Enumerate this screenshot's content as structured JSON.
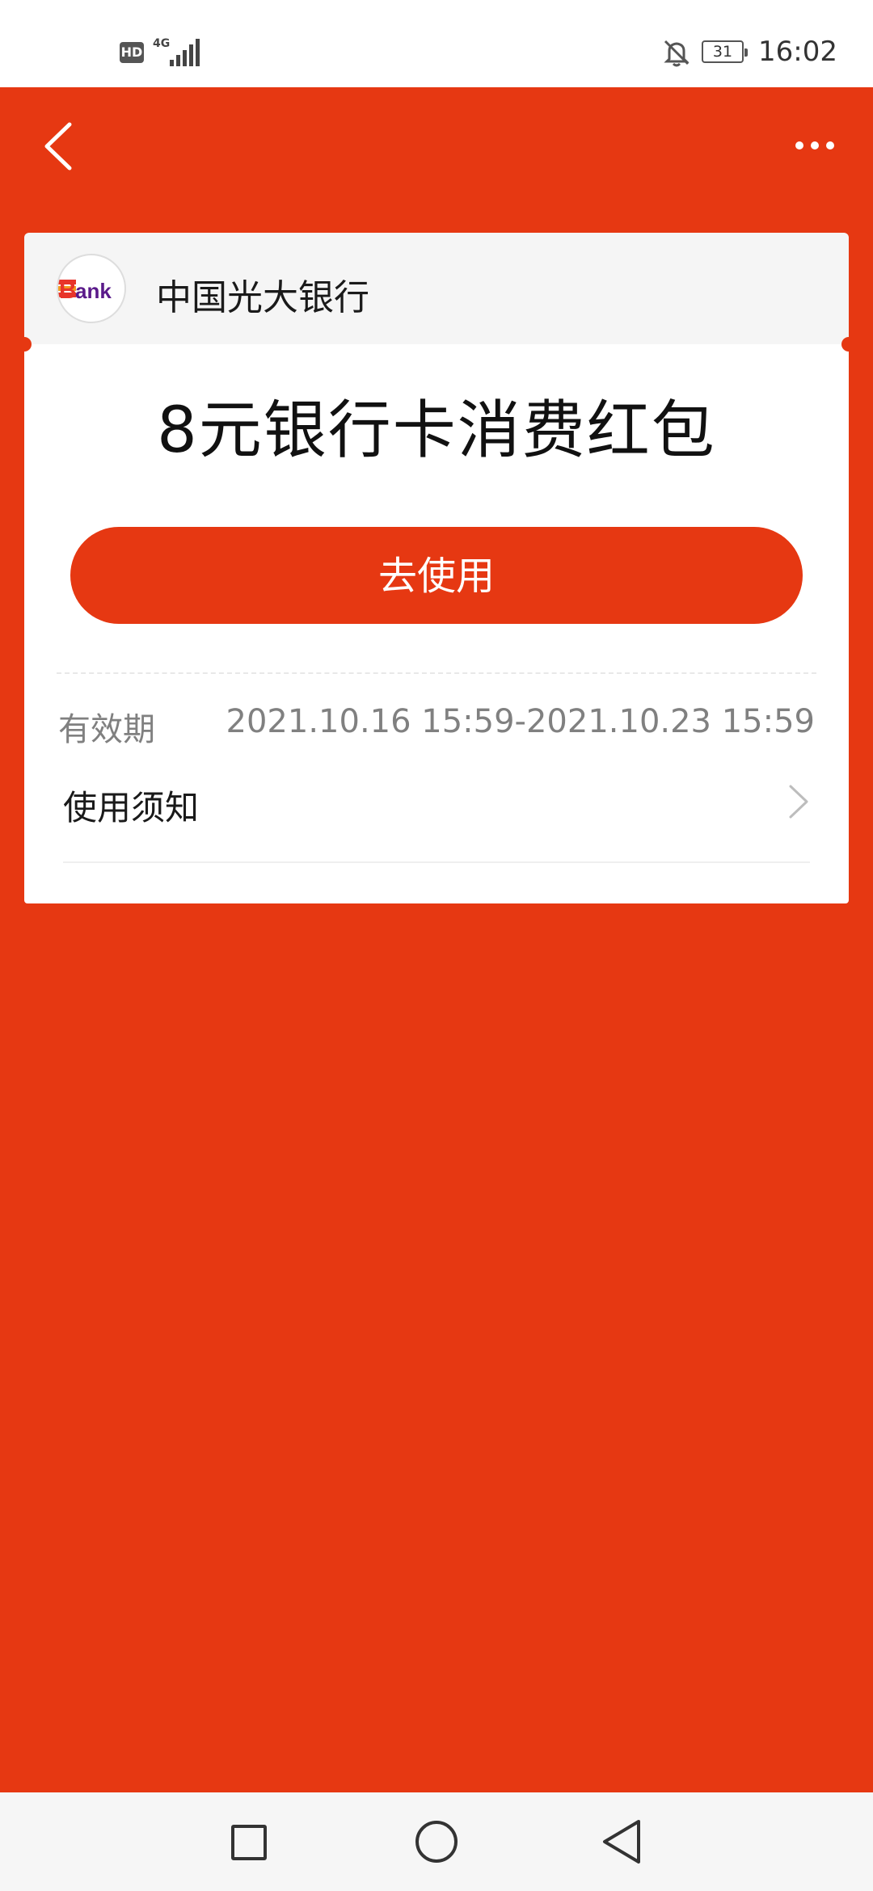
{
  "status_bar": {
    "hd": "HD",
    "network": "4G",
    "battery": "31",
    "time": "16:02"
  },
  "header": {
    "back_icon": "chevron-left-icon",
    "more_icon": "more-horizontal-icon"
  },
  "card": {
    "bank_logo_text": "Bank",
    "bank_name": "中国光大银行",
    "title": "8元银行卡消费红包",
    "use_button": "去使用",
    "validity_label": "有效期",
    "validity_value": "2021.10.16 15:59-2021.10.23 15:59",
    "notice_label": "使用须知"
  },
  "nav_bar": {
    "recent": "square-icon",
    "home": "circle-icon",
    "back": "triangle-back-icon"
  },
  "colors": {
    "accent": "#E63812",
    "card_header_bg": "#F5F5F5",
    "muted_text": "#808080"
  }
}
